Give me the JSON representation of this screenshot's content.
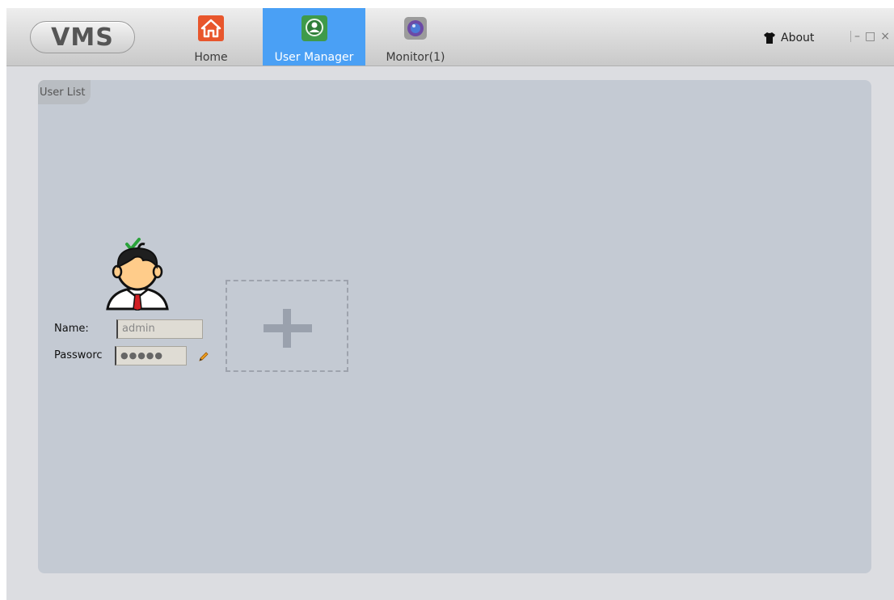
{
  "app": {
    "logo": "VMS"
  },
  "nav": {
    "tabs": [
      {
        "label": "Home",
        "icon": "home-icon",
        "active": false
      },
      {
        "label": "User Manager",
        "icon": "user-manager-icon",
        "active": true
      },
      {
        "label": "Monitor(1)",
        "icon": "monitor-icon",
        "active": false
      }
    ]
  },
  "header": {
    "about_label": "About",
    "about_icon": "tshirt-icon"
  },
  "window_controls": {
    "minimize": "–",
    "maximize": "□",
    "close": "×"
  },
  "panel": {
    "tab_label": "User List"
  },
  "user": {
    "name_label": "Name:",
    "name_value": "admin",
    "password_label": "Passworc",
    "password_value": "●●●●●"
  },
  "colors": {
    "active_tab": "#4aa0f5",
    "panel_bg": "#c4cad3",
    "window_bg": "#dcdde1"
  }
}
